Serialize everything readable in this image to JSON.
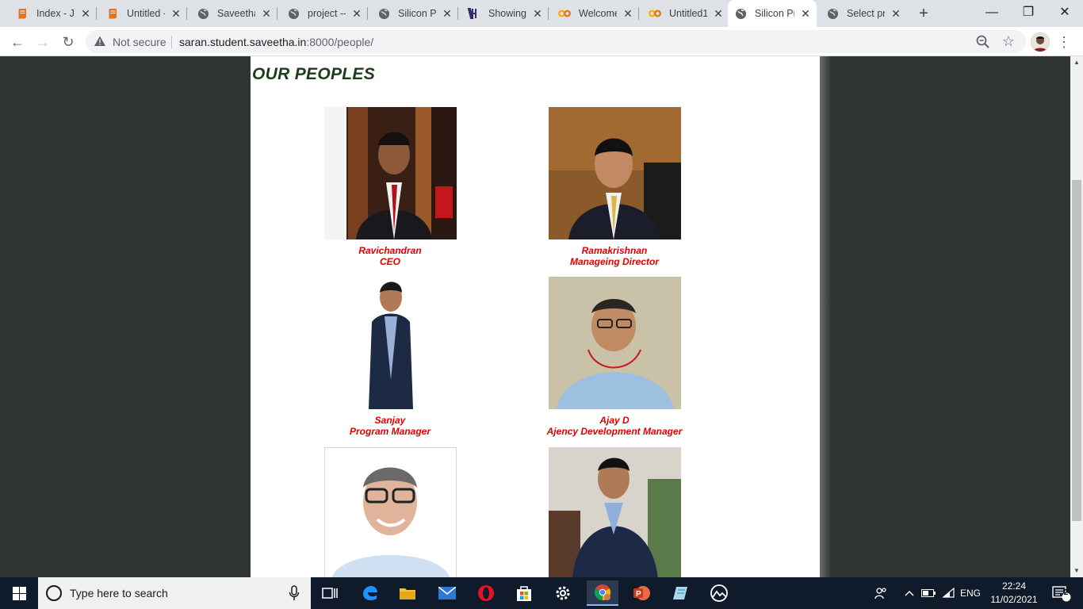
{
  "browser": {
    "tabs": [
      {
        "title": "Index - Ju",
        "favicon": "notebook-icon",
        "active": false
      },
      {
        "title": "Untitled -",
        "favicon": "notebook-icon",
        "active": false
      },
      {
        "title": "Saveetha",
        "favicon": "globe-icon",
        "active": false
      },
      {
        "title": "project --",
        "favicon": "globe-icon",
        "active": false
      },
      {
        "title": "Silicon Pr",
        "favicon": "globe-icon",
        "active": false
      },
      {
        "title": "Showing",
        "favicon": "hu-logo-icon",
        "active": false
      },
      {
        "title": "Welcome",
        "favicon": "colab-icon",
        "active": false
      },
      {
        "title": "Untitled1",
        "favicon": "colab-icon",
        "active": false
      },
      {
        "title": "Silicon Pr",
        "favicon": "globe-icon",
        "active": true
      },
      {
        "title": "Select pr",
        "favicon": "globe-icon",
        "active": false
      }
    ],
    "new_tab": "+",
    "window_controls": {
      "minimize": "—",
      "restore": "❐",
      "close": "✕"
    },
    "toolbar": {
      "back": "←",
      "forward": "→",
      "reload": "↻",
      "security_label": "Not secure",
      "url_host": "saran.student.saveetha.in",
      "url_path": ":8000/people/",
      "star": "☆",
      "menu": "⋮"
    }
  },
  "page": {
    "heading": "OUR PEOPLES",
    "people": [
      {
        "name": "Ravichandran",
        "role": "CEO"
      },
      {
        "name": "Ramakrishnan",
        "role": "Manageing Director"
      },
      {
        "name": "Sanjay",
        "role": "Program Manager"
      },
      {
        "name": "Ajay D",
        "role": "Ajency Development Manager"
      },
      {
        "name": "",
        "role": ""
      },
      {
        "name": "",
        "role": ""
      }
    ]
  },
  "taskbar": {
    "search_placeholder": "Type here to search",
    "language": "ENG",
    "time": "22:24",
    "date": "11/02/2021",
    "notifications": "2"
  },
  "colors": {
    "heading": "#1c3d1c",
    "caption": "#e00000",
    "background": "#2f3530",
    "taskbar": "#0f1a2a"
  }
}
